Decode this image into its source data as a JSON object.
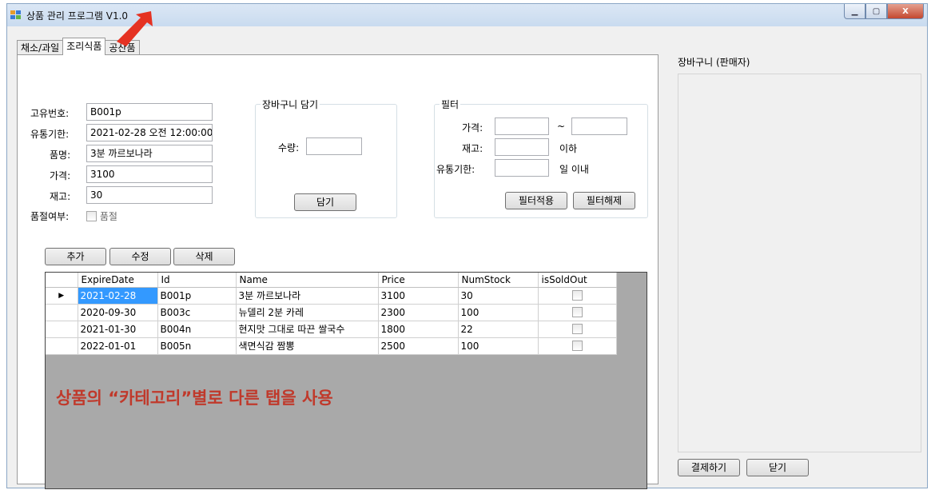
{
  "window": {
    "title": "상품 관리 프로그램 V1.0",
    "buttons": {
      "minimize": "▁",
      "maximize": "▢",
      "close": "X"
    }
  },
  "tabs": [
    "채소/과일",
    "조리식품",
    "공산품"
  ],
  "active_tab_index": 1,
  "form": {
    "id_label": "고유번호:",
    "id_value": "B001p",
    "expire_label": "유통기한:",
    "expire_value": "2021-02-28 오전 12:00:00",
    "name_label": "품명:",
    "name_value": "3분 까르보나라",
    "price_label": "가격:",
    "price_value": "3100",
    "stock_label": "재고:",
    "stock_value": "30",
    "soldout_label": "품절여부:",
    "soldout_check_label": "품절"
  },
  "cart_group": {
    "title": "장바구니 담기",
    "qty_label": "수량:",
    "qty_value": "",
    "add_button": "담기"
  },
  "filter_group": {
    "title": "필터",
    "price_label": "가격:",
    "range_sep": "~",
    "stock_label": "재고:",
    "stock_suffix": "이하",
    "expire_label": "유통기한:",
    "expire_suffix": "일 이내",
    "apply_button": "필터적용",
    "clear_button": "필터해제"
  },
  "actions": {
    "add": "추가",
    "edit": "수정",
    "delete": "삭제"
  },
  "grid": {
    "columns": [
      "ExpireDate",
      "Id",
      "Name",
      "Price",
      "NumStock",
      "isSoldOut"
    ],
    "rows": [
      [
        "2021-02-28",
        "B001p",
        "3분 까르보나라",
        "3100",
        "30"
      ],
      [
        "2020-09-30",
        "B003c",
        "뉴델리 2분 카레",
        "2300",
        "100"
      ],
      [
        "2021-01-30",
        "B004n",
        "현지맛 그대로 따끈 쌀국수",
        "1800",
        "22"
      ],
      [
        "2022-01-01",
        "B005n",
        "색면식감 짬뽕",
        "2500",
        "100"
      ]
    ],
    "current_row_marker": "▶"
  },
  "annotation": "상품의 “카테고리”별로 다른 탭을 사용",
  "seller_cart": {
    "title": "장바구니 (판매자)",
    "pay_button": "결제하기",
    "close_button": "닫기"
  },
  "colors": {
    "annotation": "#c0392b",
    "arrow": "#e53222",
    "selection": "#3399ff"
  }
}
